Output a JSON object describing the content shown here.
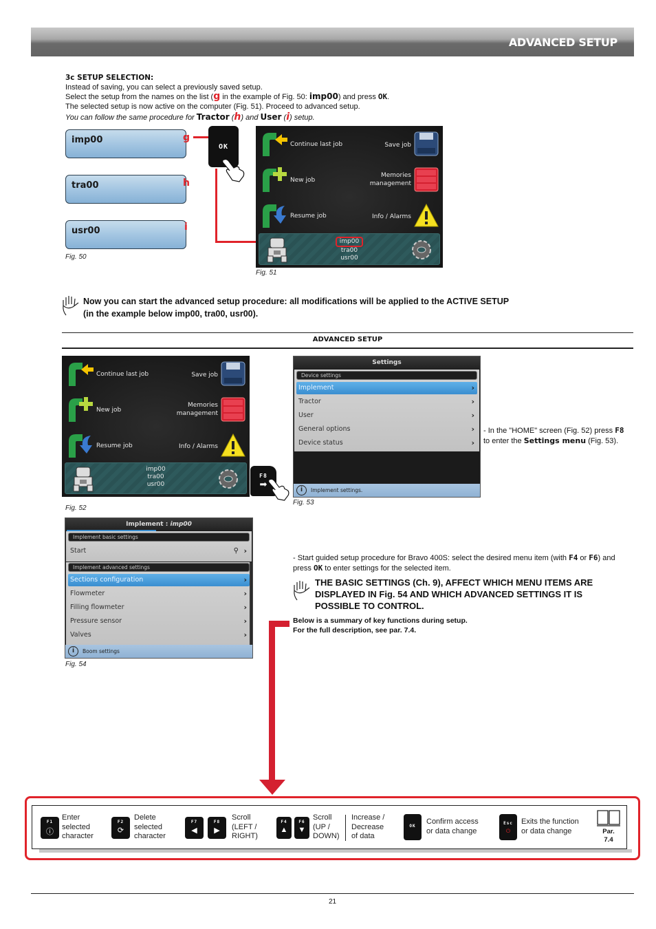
{
  "header": {
    "title": "ADVANCED SETUP"
  },
  "section3c": {
    "heading": "3c SETUP SELECTION:",
    "line1": "Instead of saving, you can select a previously saved setup.",
    "line2_a": "Select the setup from the names on the list (",
    "line2_g": "g",
    "line2_b": " in the example of Fig. 50: ",
    "line2_imp": "imp00",
    "line2_c": ") and press ",
    "line2_ok": "OK",
    "line2_d": ".",
    "line3": "The selected setup is now active on the computer (Fig. 51). Proceed to advanced setup.",
    "line4_a": "You can follow the same procedure for ",
    "line4_tractor": "Tractor",
    "line4_h": "h",
    "line4_b": " and ",
    "line4_user": "User",
    "line4_i": "i",
    "line4_c": " setup."
  },
  "fig50": {
    "caption": "Fig. 50",
    "boxes": [
      {
        "name": "imp00",
        "letter": "g"
      },
      {
        "name": "tra00",
        "letter": "h"
      },
      {
        "name": "usr00",
        "letter": "i"
      }
    ],
    "ok_key": "OK"
  },
  "fig51": {
    "caption": "Fig. 51",
    "items_left": [
      "Continue last job",
      "New job",
      "Resume job"
    ],
    "items_right": [
      "Save job",
      "Memories management",
      "Info / Alarms"
    ],
    "active_setup": [
      "imp00",
      "tra00",
      "usr00"
    ]
  },
  "note1": {
    "line1": "Now you can start the advanced setup procedure: all modifications will be applied to the ACTIVE SETUP",
    "line2": "(in the example below imp00, tra00, usr00)."
  },
  "advanced_title": "ADVANCED SETUP",
  "fig52": {
    "caption": "Fig. 52",
    "items_left": [
      "Continue last job",
      "New job",
      "Resume job"
    ],
    "items_right": [
      "Save job",
      "Memories management",
      "Info / Alarms"
    ],
    "active_setup": [
      "imp00",
      "tra00",
      "usr00"
    ],
    "f8_key": "F8"
  },
  "fig53": {
    "caption": "Fig. 53",
    "title": "Settings",
    "section": "Device settings",
    "items": [
      "Implement",
      "Tractor",
      "User",
      "General options",
      "Device status"
    ],
    "selected_index": 0,
    "info": "Implement settings."
  },
  "home_instruction": {
    "a": "- In the \"HOME\" screen (Fig. 52) press ",
    "key": "F8",
    "b": "to enter the ",
    "menu": "Settings menu",
    "c": " (Fig. 53)."
  },
  "fig54": {
    "caption": "Fig. 54",
    "title_a": "Implement : ",
    "title_b": "imp00",
    "section_basic": "Implement basic settings",
    "basic_items": [
      "Start"
    ],
    "section_adv": "Implement advanced settings",
    "adv_items": [
      "Sections configuration",
      "Flowmeter",
      "Filling flowmeter",
      "Pressure sensor",
      "Valves"
    ],
    "selected_index": 0,
    "info": "Boom settings"
  },
  "guided_instruction": {
    "a": "- Start guided setup procedure for Bravo 400S: select the desired menu item (with ",
    "k1": "F4",
    "or": " or ",
    "k2": "F6",
    "b": ") and",
    "c": "press ",
    "ok": "OK",
    "d": " to enter settings for the selected item."
  },
  "note2": {
    "line1": "THE BASIC SETTINGS (Ch. 9), AFFECT WHICH MENU ITEMS ARE",
    "line2": "DISPLAYED IN Fig. 54 AND WHICH ADVANCED SETTINGS IT IS",
    "line3": "POSSIBLE TO CONTROL."
  },
  "summary": {
    "line1": "Below is a summary of key functions during setup.",
    "line2": "For the full description, see par. 7.4."
  },
  "legend": {
    "items": [
      {
        "keys": [
          "F1"
        ],
        "lines": [
          "Enter",
          "selected",
          "character"
        ]
      },
      {
        "keys": [
          "F2"
        ],
        "lines": [
          "Delete",
          "selected",
          "character"
        ]
      },
      {
        "keys": [
          "F7",
          "F8"
        ],
        "lines": [
          "Scroll",
          "(LEFT /",
          "RIGHT)"
        ]
      },
      {
        "keys": [
          "F4",
          "F6"
        ],
        "lines": [
          "Scroll",
          "(UP /",
          "DOWN)"
        ]
      },
      {
        "keys": [],
        "lines": [
          "Increase /",
          "Decrease",
          "of data"
        ]
      },
      {
        "keys": [
          "OK"
        ],
        "lines": [
          "Confirm access",
          "or data change"
        ]
      },
      {
        "keys": [
          "Esc"
        ],
        "lines": [
          "Exits the function",
          "or data change"
        ]
      }
    ],
    "par_label": "Par.",
    "par_num": "7.4"
  },
  "page_number": "21",
  "colors": {
    "accent_red": "#e0232a",
    "header_gray": "#646464",
    "selection_blue": "#3a8ed0"
  }
}
